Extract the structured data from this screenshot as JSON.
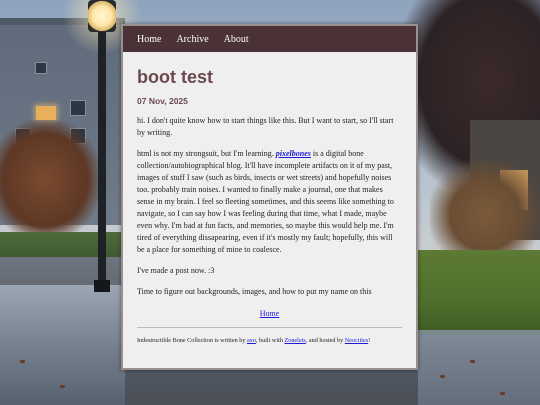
{
  "nav": {
    "items": [
      "Home",
      "Archive",
      "About"
    ]
  },
  "post": {
    "title": "boot test",
    "date": "07 Nov, 2025",
    "p1": "hi. I don't quite know how to start things like this. But I want to start, so I'll start by writing.",
    "p2_before": "html is not my strongsuit, but I'm learning. ",
    "p2_link": "pixelbones",
    "p2_after": " is a digital bone collection/autobiographical blog. It'll have incomplete artifacts on it of my past, images of stuff I saw (such as birds, insects or wet streets) and hopefully noises too. probably train noises. I wanted to finally make a journal, one that makes sense in my brain. I feel so fleeting sometimes, and this seems like something to navigate, so I can say how I was feeling during that time, what I made, maybe even why. I'm bad at fun facts, and memories, so maybe this would help me. I'm tired of everything dissapearing, even if it's mostly my fault; hopefully, this will be a place for something of mine to coalesce.",
    "p3": "I've made a post now. :3",
    "p4": "Time to figure out backgrounds, images, and how to put my name on this",
    "home_link": "Home"
  },
  "footer": {
    "text1": "Indestructible Bone Collection is written by ",
    "author": "axo",
    "text2": ", built with ",
    "tool": "Zonelets",
    "text3": ", and hosted by ",
    "host": "Neocities",
    "text4": "!"
  },
  "colors": {
    "nav_bg": "#4a3236",
    "title": "#6b4a4f",
    "link": "#1f1bd6",
    "card_bg": "#efefef"
  }
}
